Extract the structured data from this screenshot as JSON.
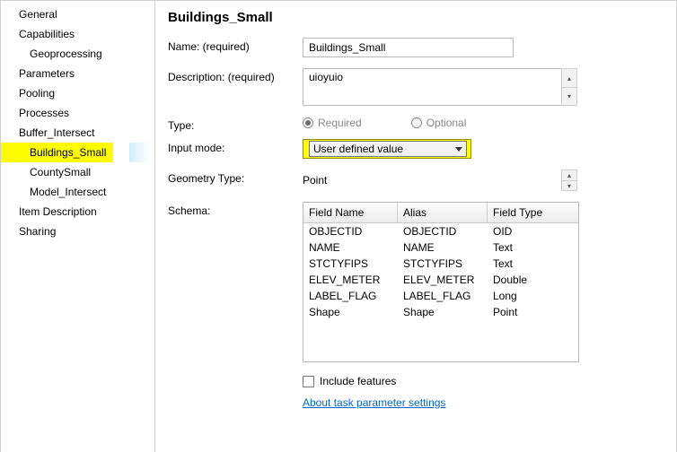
{
  "nav": {
    "items": [
      {
        "label": "General",
        "depth": 0
      },
      {
        "label": "Capabilities",
        "depth": 0
      },
      {
        "label": "Geoprocessing",
        "depth": 1
      },
      {
        "label": "Parameters",
        "depth": 0
      },
      {
        "label": "Pooling",
        "depth": 0
      },
      {
        "label": "Processes",
        "depth": 0
      },
      {
        "label": "Buffer_Intersect",
        "depth": 0
      },
      {
        "label": "Buildings_Small",
        "depth": 2,
        "selected": true
      },
      {
        "label": "CountySmall",
        "depth": 2
      },
      {
        "label": "Model_Intersect",
        "depth": 2
      },
      {
        "label": "Item Description",
        "depth": 0
      },
      {
        "label": "Sharing",
        "depth": 0
      }
    ]
  },
  "page": {
    "title": "Buildings_Small",
    "labels": {
      "name": "Name:  (required)",
      "description": "Description:  (required)",
      "type": "Type:",
      "input_mode": "Input mode:",
      "geometry_type": "Geometry Type:",
      "schema": "Schema:",
      "include_features": "Include features",
      "about_link": "About task parameter settings"
    },
    "values": {
      "name": "Buildings_Small",
      "description": "uioyuio",
      "type_required": "Required",
      "type_optional": "Optional",
      "input_mode_selected": "User defined value",
      "geometry_type": "Point"
    },
    "schema": {
      "headers": {
        "field_name": "Field Name",
        "alias": "Alias",
        "field_type": "Field Type"
      },
      "rows": [
        {
          "field_name": "OBJECTID",
          "alias": "OBJECTID",
          "field_type": "OID"
        },
        {
          "field_name": "NAME",
          "alias": "NAME",
          "field_type": "Text"
        },
        {
          "field_name": "STCTYFIPS",
          "alias": "STCTYFIPS",
          "field_type": "Text"
        },
        {
          "field_name": "ELEV_METER",
          "alias": "ELEV_METER",
          "field_type": "Double"
        },
        {
          "field_name": "LABEL_FLAG",
          "alias": "LABEL_FLAG",
          "field_type": "Long"
        },
        {
          "field_name": "Shape",
          "alias": "Shape",
          "field_type": "Point"
        }
      ]
    }
  }
}
